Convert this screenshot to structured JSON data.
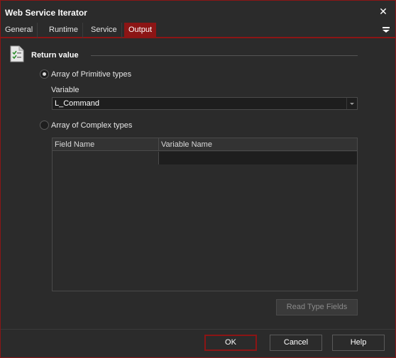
{
  "window": {
    "title": "Web Service Iterator",
    "close_label": "✕"
  },
  "tabs": [
    {
      "label": "General"
    },
    {
      "label": "Runtime"
    },
    {
      "label": "Service"
    },
    {
      "label": "Output",
      "active": true
    }
  ],
  "section": {
    "title": "Return value",
    "icon": "checklist-icon"
  },
  "options": {
    "primitive_label": "Array of Primitive types",
    "primitive_checked": true,
    "complex_label": "Array of Complex types",
    "complex_checked": false
  },
  "variable": {
    "label": "Variable",
    "value": "L_Command"
  },
  "grid": {
    "columns": [
      "Field Name",
      "Variable Name"
    ],
    "rows": [
      [
        "",
        ""
      ]
    ]
  },
  "buttons": {
    "read_type_fields": "Read Type Fields",
    "ok": "OK",
    "cancel": "Cancel",
    "help": "Help"
  },
  "colors": {
    "accent": "#8c1515",
    "background": "#2b2b2b",
    "input_background": "#1e1e1e"
  }
}
